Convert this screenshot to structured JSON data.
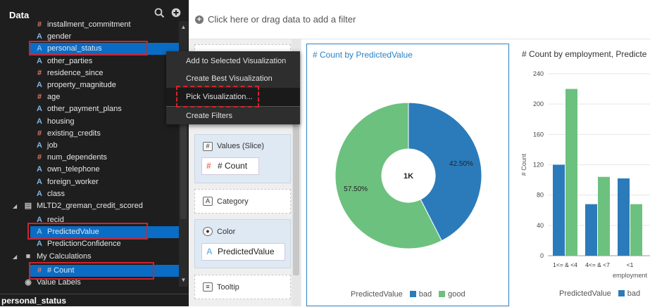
{
  "data_panel": {
    "title": "Data",
    "items": [
      {
        "type": "measure",
        "label": "installment_commitment"
      },
      {
        "type": "attribute",
        "label": "gender"
      },
      {
        "type": "attribute",
        "label": "personal_status",
        "selected": true
      },
      {
        "type": "attribute",
        "label": "other_parties"
      },
      {
        "type": "measure",
        "label": "residence_since"
      },
      {
        "type": "attribute",
        "label": "property_magnitude"
      },
      {
        "type": "measure",
        "label": "age"
      },
      {
        "type": "attribute",
        "label": "other_payment_plans"
      },
      {
        "type": "attribute",
        "label": "housing"
      },
      {
        "type": "measure",
        "label": "existing_credits"
      },
      {
        "type": "attribute",
        "label": "job"
      },
      {
        "type": "measure",
        "label": "num_dependents"
      },
      {
        "type": "attribute",
        "label": "own_telephone"
      },
      {
        "type": "attribute",
        "label": "foreign_worker"
      },
      {
        "type": "attribute",
        "label": "class"
      }
    ],
    "dataset": {
      "label": "MLTD2_greman_credit_scored"
    },
    "dataset_items": [
      {
        "type": "attribute",
        "label": "recid"
      },
      {
        "type": "attribute",
        "label": "PredictedValue",
        "selected": true
      },
      {
        "type": "attribute",
        "label": "PredictionConfidence"
      }
    ],
    "calc_folder": {
      "label": "My Calculations"
    },
    "calc_items": [
      {
        "type": "measure",
        "label": "# Count",
        "selected": true
      }
    ],
    "value_labels": "Value Labels",
    "status": "personal_status"
  },
  "filter_bar": {
    "placeholder": "Click here or drag data to add a filter"
  },
  "context_menu": {
    "items": [
      {
        "label": "Add to Selected Visualization"
      },
      {
        "label": "Create Best Visualization"
      },
      {
        "label": "Pick Visualization..."
      },
      {
        "label": "Create Filters"
      }
    ],
    "active_index": 2
  },
  "grammar": {
    "values_slice": {
      "label": "Values (Slice)",
      "chip": "# Count"
    },
    "category": {
      "label": "Category"
    },
    "color": {
      "label": "Color",
      "chip": "PredictedValue"
    },
    "tooltip": {
      "label": "Tooltip"
    }
  },
  "colors": {
    "accent": "#2b80c5",
    "bad": "#2b7bba",
    "good": "#6cc17f",
    "highlight": "#d2232a",
    "selected_row": "#0a6cc4"
  },
  "chart_data": [
    {
      "type": "pie",
      "title": "# Count by PredictedValue",
      "center_label": "1K",
      "slices": [
        {
          "name": "bad",
          "value": 42.5,
          "label": "42.50%"
        },
        {
          "name": "good",
          "value": 57.5,
          "label": "57.50%"
        }
      ],
      "legend": {
        "title": "PredictedValue",
        "entries": [
          "bad",
          "good"
        ],
        "position": "bottom"
      }
    },
    {
      "type": "bar",
      "title": "# Count by employment, Predicte",
      "categories": [
        "1<= & <4",
        "4<= & <7",
        "<1"
      ],
      "series": [
        {
          "name": "bad",
          "values": [
            120,
            68,
            102
          ]
        },
        {
          "name": "good",
          "values": [
            220,
            104,
            68
          ]
        }
      ],
      "ylabel": "# Count",
      "xlabel": "employment",
      "ylim": [
        0,
        240
      ],
      "yticks": [
        0,
        40,
        80,
        120,
        160,
        200,
        240
      ],
      "grid": true,
      "legend": {
        "title": "PredictedValue",
        "entries": [
          "bad"
        ],
        "position": "bottom"
      }
    }
  ]
}
